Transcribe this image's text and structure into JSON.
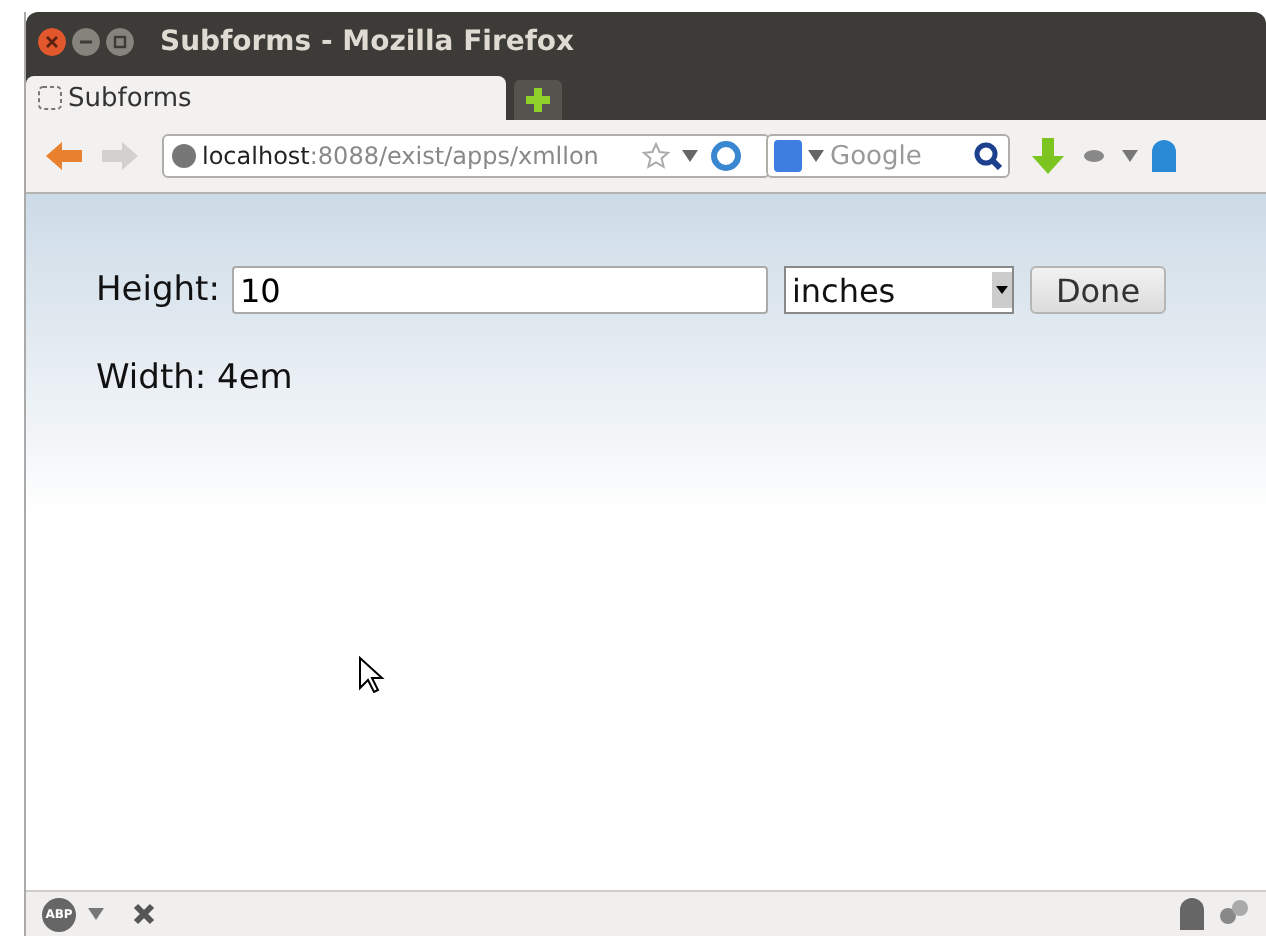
{
  "window": {
    "title": "Subforms - Mozilla Firefox"
  },
  "tabs": [
    {
      "label": "Subforms",
      "selected": true
    }
  ],
  "address_bar": {
    "host": "localhost",
    "rest": ":8088/exist/apps/xmllon"
  },
  "search": {
    "placeholder": "Google"
  },
  "form": {
    "height_label": "Height:",
    "height_value": "10",
    "unit": "inches",
    "done_button": "Done",
    "width_text": "Width: 4em"
  },
  "status_bar": {
    "adblock_label": "ABP"
  }
}
